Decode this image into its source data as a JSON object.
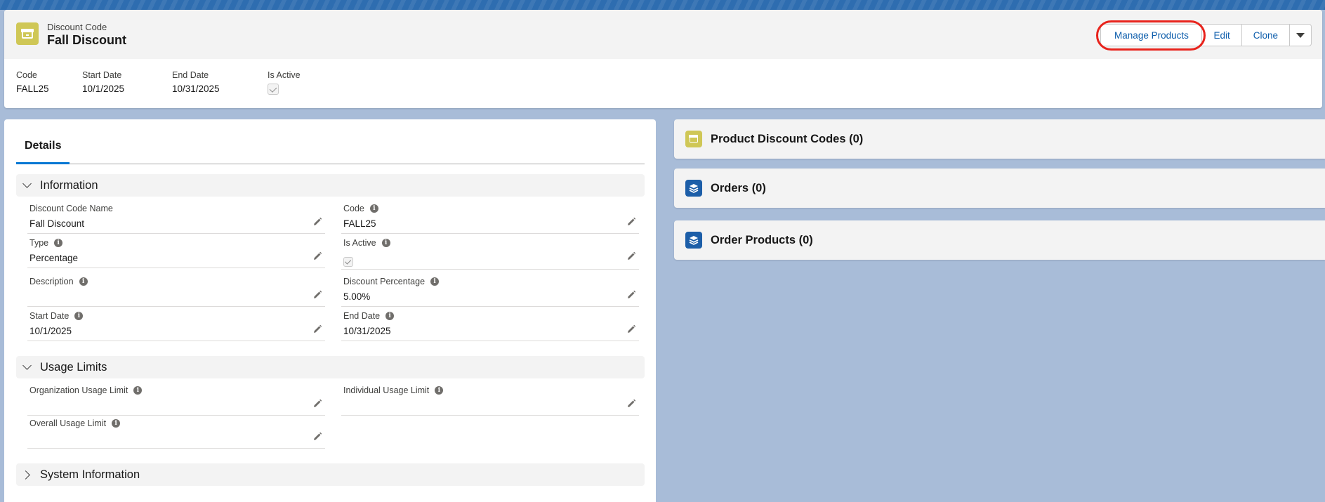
{
  "record": {
    "object_type": "Discount Code",
    "name": "Fall Discount"
  },
  "actions": {
    "manage_products": "Manage Products",
    "edit": "Edit",
    "clone": "Clone"
  },
  "highlights": [
    {
      "label": "Code",
      "value": "FALL25"
    },
    {
      "label": "Start Date",
      "value": "10/1/2025"
    },
    {
      "label": "End Date",
      "value": "10/31/2025"
    },
    {
      "label": "Is Active",
      "value": ""
    }
  ],
  "tabs": {
    "details": "Details"
  },
  "sections": {
    "information": "Information",
    "usage_limits": "Usage Limits",
    "system_information": "System Information"
  },
  "fields": {
    "discount_code_name": {
      "label": "Discount Code Name",
      "value": "Fall Discount"
    },
    "code": {
      "label": "Code",
      "value": "FALL25"
    },
    "type": {
      "label": "Type",
      "value": "Percentage"
    },
    "is_active": {
      "label": "Is Active",
      "value": ""
    },
    "description": {
      "label": "Description",
      "value": ""
    },
    "discount_percentage": {
      "label": "Discount Percentage",
      "value": "5.00%"
    },
    "start_date": {
      "label": "Start Date",
      "value": "10/1/2025"
    },
    "end_date": {
      "label": "End Date",
      "value": "10/31/2025"
    },
    "organization_usage_limit": {
      "label": "Organization Usage Limit",
      "value": ""
    },
    "individual_usage_limit": {
      "label": "Individual Usage Limit",
      "value": ""
    },
    "overall_usage_limit": {
      "label": "Overall Usage Limit",
      "value": ""
    }
  },
  "related_lists": {
    "product_discount_codes": "Product Discount Codes (0)",
    "orders": "Orders (0)",
    "order_products": "Order Products (0)"
  },
  "colors": {
    "page_bg": "#a8bcd8",
    "accent_blue": "#0176d3",
    "discount_icon": "#cfc756",
    "order_icon": "#1c5ea8",
    "highlight_ring": "#e8231c"
  }
}
